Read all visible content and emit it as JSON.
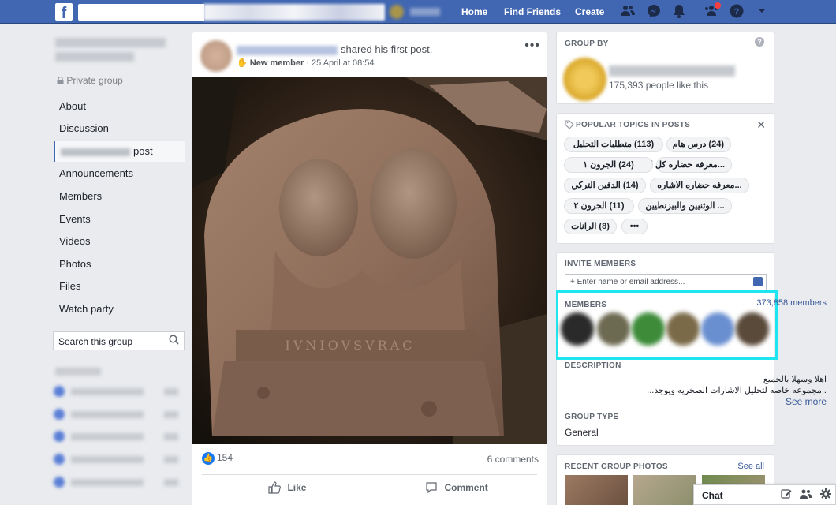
{
  "topbar": {
    "nav": [
      "Home",
      "Find Friends",
      "Create"
    ],
    "icons": [
      "friends-icon",
      "messenger-icon",
      "notifications-icon",
      "groups-icon",
      "help-icon",
      "dropdown-icon"
    ]
  },
  "left": {
    "privacy": "Private group",
    "nav_items": [
      "About",
      "Discussion",
      "post",
      "Announcements",
      "Members",
      "Events",
      "Videos",
      "Photos",
      "Files",
      "Watch party"
    ],
    "search_placeholder": "Search this group"
  },
  "post": {
    "action_text": "shared his first post.",
    "badge": "New member",
    "timestamp": "· 25 April at 08:54",
    "reactions": "154",
    "comments": "6 comments",
    "actions": [
      "Like",
      "Comment"
    ]
  },
  "group_by": {
    "title": "GROUP BY",
    "likes": "175,393 people like this"
  },
  "popular_topics": {
    "title": "POPULAR TOPICS IN POSTS",
    "chips": [
      "(24) درس هام",
      "(113) متطلبات التحليل",
      "...معرفه حضاره كل اشاره",
      "(24) الجرون ١",
      "...معرفه حضاره الاشاره",
      "(14) الدفين التركي",
      "... الوثنيين والبيزنطيين",
      "(11) الجرون ٢",
      "(8) الرانات",
      "•••"
    ]
  },
  "invite": {
    "title": "INVITE MEMBERS",
    "placeholder": "+ Enter name or email address..."
  },
  "members": {
    "title": "MEMBERS",
    "count": "373,858 members"
  },
  "description": {
    "title": "DESCRIPTION",
    "line1": "اهلا وسهلا بالجميع",
    "line2": ". مجموعه خاصه لتحليل الاشارات الصخريه ويوجد...",
    "see_more": "See more"
  },
  "group_type": {
    "title": "GROUP TYPE",
    "value": "General"
  },
  "recent_photos": {
    "title": "RECENT GROUP PHOTOS",
    "see_all": "See all"
  },
  "chat": {
    "label": "Chat"
  },
  "colors": {
    "brand": "#4267b2",
    "highlight": "#1ee6f0",
    "link": "#385898"
  }
}
